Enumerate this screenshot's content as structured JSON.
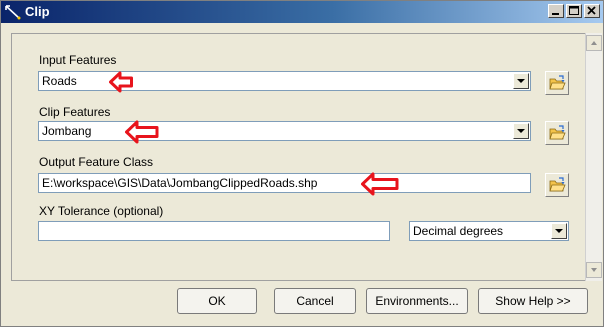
{
  "window": {
    "title": "Clip"
  },
  "titlebar_buttons": {
    "minimize_icon": "minimize-icon",
    "maximize_icon": "maximize-icon",
    "close_icon": "close-icon"
  },
  "fields": {
    "input_features": {
      "label": "Input Features",
      "value": "Roads"
    },
    "clip_features": {
      "label": "Clip Features",
      "value": "Jombang"
    },
    "output_feature_class": {
      "label": "Output Feature Class",
      "value": "E:\\workspace\\GIS\\Data\\JombangClippedRoads.shp"
    },
    "xy_tolerance": {
      "label": "XY Tolerance (optional)",
      "value": "",
      "unit": "Decimal degrees"
    }
  },
  "buttons": {
    "ok": "OK",
    "cancel": "Cancel",
    "environments": "Environments...",
    "show_help": "Show Help >>"
  },
  "colors": {
    "annotation_arrow": "#e8141c",
    "titlebar_start": "#0a246a",
    "titlebar_end": "#a6caf0"
  }
}
